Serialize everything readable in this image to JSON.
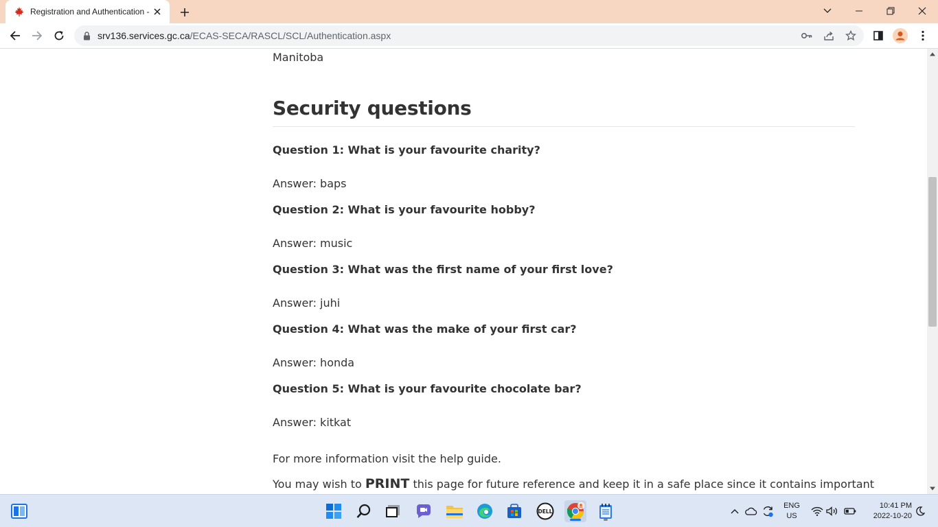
{
  "browser": {
    "tab_title": "Registration and Authentication -",
    "url_host": "srv136.services.gc.ca",
    "url_path": "/ECAS-SECA/RASCL/SCL/Authentication.aspx"
  },
  "page": {
    "province": "Manitoba",
    "section_title": "Security questions",
    "answer_label": "Answer:",
    "questions": [
      {
        "question": "Question 1: What is your favourite charity?",
        "answer": "baps"
      },
      {
        "question": "Question 2: What is your favourite hobby?",
        "answer": "music"
      },
      {
        "question": "Question 3: What was the first name of your first love?",
        "answer": "juhi"
      },
      {
        "question": "Question 4: What was the make of your first car?",
        "answer": "honda"
      },
      {
        "question": "Question 5: What is your favourite chocolate bar?",
        "answer": "kitkat"
      }
    ],
    "help_text": "For more information visit the help guide.",
    "print_prefix": "You may wish to",
    "print_word": "PRINT",
    "print_suffix": "this page for future reference and keep it in a safe place since it contains important"
  },
  "taskbar": {
    "lang_line1": "ENG",
    "lang_line2": "US",
    "time": "10:41 PM",
    "date": "2022-10-20"
  },
  "colors": {
    "tabstrip": "#f8d7c2",
    "text": "#333333",
    "taskbar": "#dce6f4"
  }
}
